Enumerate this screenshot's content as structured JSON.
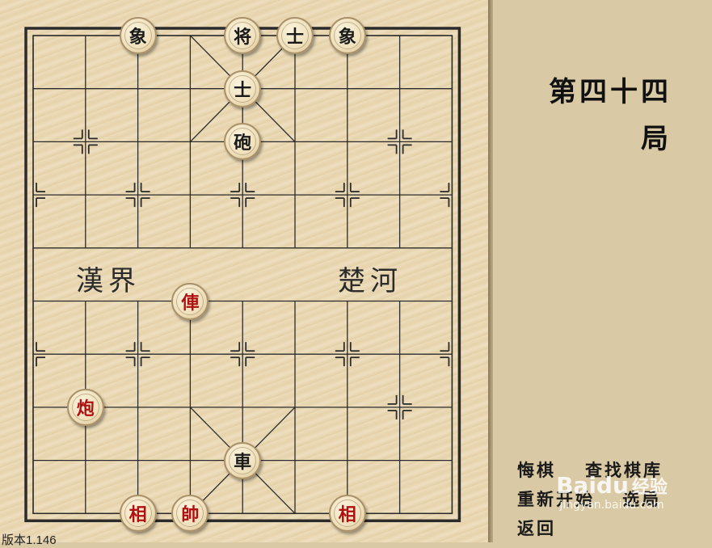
{
  "puzzle": {
    "title_line1": "第四十四",
    "title_line2": "局"
  },
  "river": {
    "left_text": "漢界",
    "right_text": "楚河"
  },
  "menu": {
    "undo": "悔棋",
    "search_library": "查找棋库",
    "restart": "重新开始",
    "select": "选局",
    "back": "返回"
  },
  "version": "版本1.146",
  "watermark": {
    "logo": "Baidu",
    "name": "经验",
    "url": "jingyan.baidu.com"
  },
  "pieces": [
    {
      "name": "象",
      "side": "black",
      "file": 2,
      "rank": 0
    },
    {
      "name": "将",
      "side": "black",
      "file": 4,
      "rank": 0
    },
    {
      "name": "士",
      "side": "black",
      "file": 5,
      "rank": 0
    },
    {
      "name": "象",
      "side": "black",
      "file": 6,
      "rank": 0
    },
    {
      "name": "士",
      "side": "black",
      "file": 4,
      "rank": 1
    },
    {
      "name": "砲",
      "side": "black",
      "file": 4,
      "rank": 2
    },
    {
      "name": "俥",
      "side": "red",
      "file": 3,
      "rank": 5
    },
    {
      "name": "炮",
      "side": "red",
      "file": 1,
      "rank": 7
    },
    {
      "name": "車",
      "side": "black",
      "file": 4,
      "rank": 8
    },
    {
      "name": "相",
      "side": "red",
      "file": 2,
      "rank": 9
    },
    {
      "name": "帥",
      "side": "red",
      "file": 3,
      "rank": 9
    },
    {
      "name": "相",
      "side": "red",
      "file": 6,
      "rank": 9
    }
  ],
  "colors": {
    "red_piece": "#b01010",
    "black_piece": "#1a1a1a",
    "line": "#2b2b2b"
  }
}
